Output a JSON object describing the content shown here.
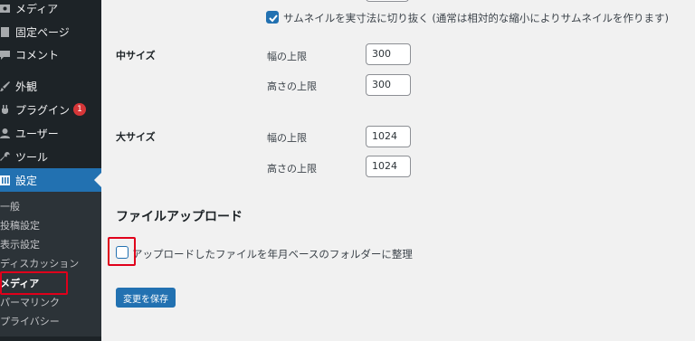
{
  "sidebar": {
    "items": [
      {
        "label": "メディア",
        "icon": "media-icon"
      },
      {
        "label": "固定ページ",
        "icon": "page-icon"
      },
      {
        "label": "コメント",
        "icon": "comment-icon"
      },
      {
        "label": "外観",
        "icon": "brush-icon"
      },
      {
        "label": "プラグイン",
        "icon": "plugin-icon",
        "badge": "1"
      },
      {
        "label": "ユーザー",
        "icon": "user-icon"
      },
      {
        "label": "ツール",
        "icon": "wrench-icon"
      },
      {
        "label": "設定",
        "icon": "settings-icon",
        "active": true
      }
    ],
    "submenu": [
      "一般",
      "投稿設定",
      "表示設定",
      "ディスカッション",
      "メディア",
      "パーマリンク",
      "プライバシー"
    ]
  },
  "main": {
    "crop_checkbox_label": "サムネイルを実寸法に切り抜く (通常は相対的な縮小によりサムネイルを作ります)",
    "medium": {
      "title": "中サイズ",
      "width_label": "幅の上限",
      "width_value": "300",
      "height_label": "高さの上限",
      "height_value": "300"
    },
    "large": {
      "title": "大サイズ",
      "width_label": "幅の上限",
      "width_value": "1024",
      "height_label": "高さの上限",
      "height_value": "1024"
    },
    "upload_section": {
      "heading": "ファイルアップロード",
      "checkbox_label": "アップロードしたファイルを年月ベースのフォルダーに整理"
    },
    "save_button": "変更を保存"
  },
  "colors": {
    "accent": "#2271b1",
    "sidebar": "#1d2327",
    "submenu": "#2c3338",
    "highlight": "#e0001b",
    "badge": "#d63638"
  }
}
